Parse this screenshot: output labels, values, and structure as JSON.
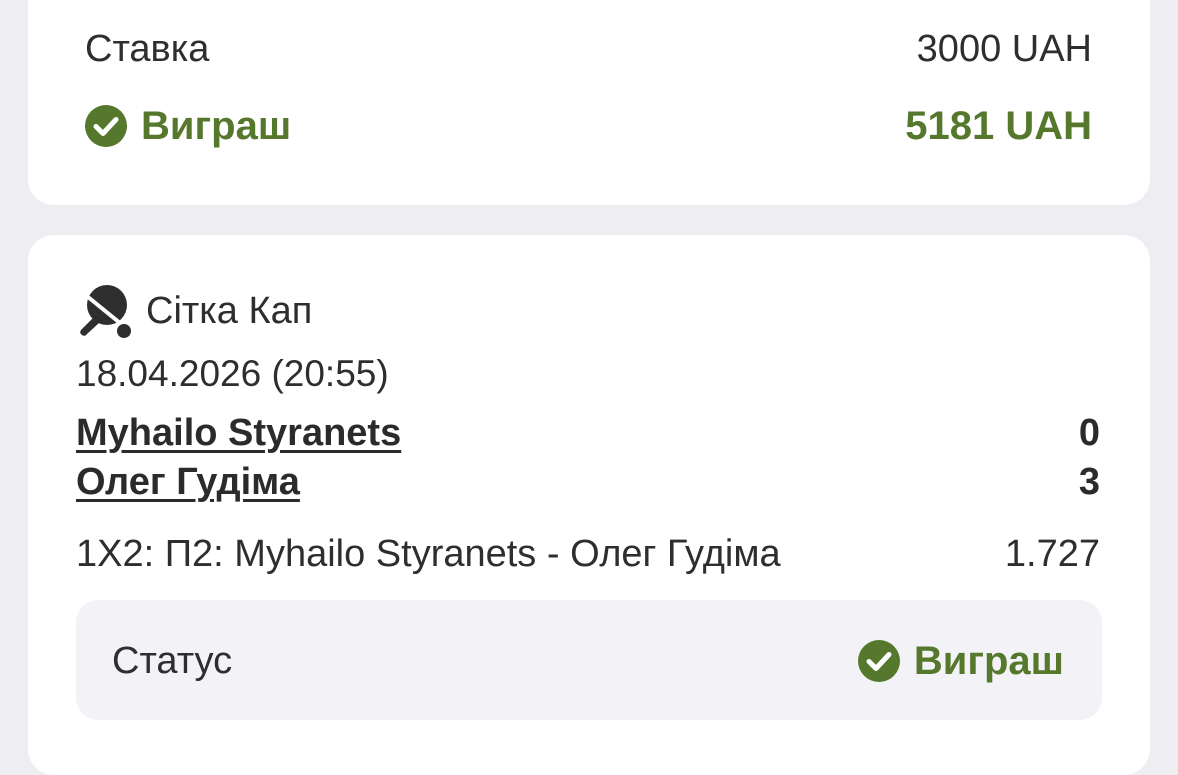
{
  "summary": {
    "stake_label": "Ставка",
    "stake_value": "3000 UAH",
    "win_label": "Виграш",
    "win_value": "5181 UAH"
  },
  "event": {
    "sport_icon": "table-tennis-icon",
    "league": "Сітка Кап",
    "datetime": "18.04.2026 (20:55)",
    "team1": {
      "name": "Myhailo Styranets",
      "score": "0"
    },
    "team2": {
      "name": "Олег Гудіма",
      "score": "3"
    },
    "market": "1X2: П2: Myhailo Styranets - Олег Гудіма",
    "odds": "1.727",
    "status_label": "Статус",
    "status_value": "Виграш"
  },
  "colors": {
    "win_green": "#56782c",
    "background": "#ededf2",
    "card": "#ffffff",
    "status_box": "#f3f3f7"
  }
}
